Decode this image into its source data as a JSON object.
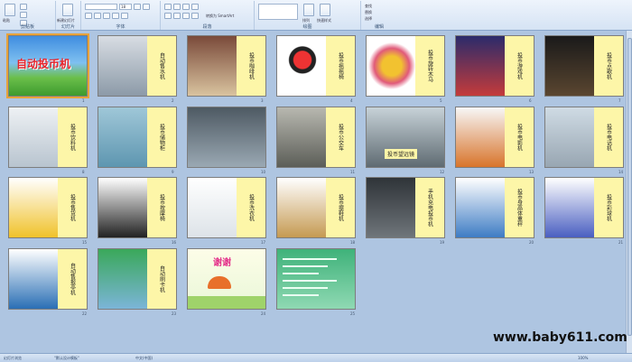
{
  "ribbon": {
    "groups": [
      {
        "label": "剪贴板"
      },
      {
        "label": "幻灯片"
      },
      {
        "label": "字体"
      },
      {
        "label": "段落"
      },
      {
        "label": "绘图"
      },
      {
        "label": "编辑"
      }
    ],
    "buttons": {
      "paste": "粘贴",
      "new_slide": "新建幻灯片",
      "font_size": "18",
      "smartart": "转换为 SmartArt",
      "arrange": "排列",
      "quick_styles": "快速样式",
      "find": "查找",
      "replace": "替换",
      "select": "选择"
    }
  },
  "slides": [
    {
      "num": "1",
      "title": "自动投币机",
      "type": "title"
    },
    {
      "num": "2",
      "title": "自动售水机"
    },
    {
      "num": "3",
      "title": "投币咖啡机"
    },
    {
      "num": "4",
      "title": "投币摇摇椅"
    },
    {
      "num": "5",
      "title": "投币旋转木马"
    },
    {
      "num": "6",
      "title": "投币游戏机"
    },
    {
      "num": "7",
      "title": "投币点歌机"
    },
    {
      "num": "8",
      "title": "投币饮料机"
    },
    {
      "num": "9",
      "title": "投币储物柜"
    },
    {
      "num": "10",
      "title": ""
    },
    {
      "num": "11",
      "title": "投币公交车"
    },
    {
      "num": "12",
      "title": "投币望远镜"
    },
    {
      "num": "13",
      "title": "投币电影机"
    },
    {
      "num": "14",
      "title": "投币电话机"
    },
    {
      "num": "15",
      "title": "投币售货机"
    },
    {
      "num": "16",
      "title": "投币按摩椅"
    },
    {
      "num": "17",
      "title": "投币洗衣机"
    },
    {
      "num": "18",
      "title": "投币擦鞋机"
    },
    {
      "num": "19",
      "title": "手机充电投币机"
    },
    {
      "num": "20",
      "title": "投币身高体重秤"
    },
    {
      "num": "21",
      "title": "投币彩球机"
    },
    {
      "num": "22",
      "title": "自动售报亭机"
    },
    {
      "num": "23",
      "title": "自动刷卡机"
    },
    {
      "num": "24",
      "title": "谢谢",
      "type": "thanks"
    },
    {
      "num": "25",
      "title": "",
      "type": "info"
    }
  ],
  "status": {
    "slide_info": "幻灯片浏览",
    "theme": "\"默认设计模板\"",
    "language": "中文(中国)",
    "zoom": "100%"
  },
  "watermark": "www.baby611.com"
}
